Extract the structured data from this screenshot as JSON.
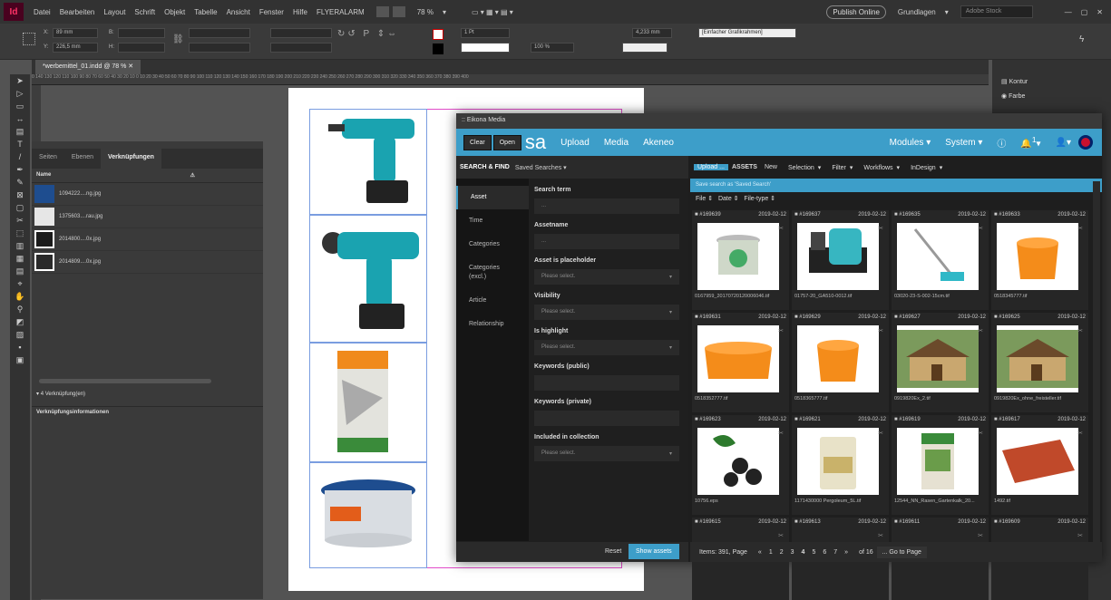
{
  "menubar": {
    "logo": "Id",
    "items": [
      "Datei",
      "Bearbeiten",
      "Layout",
      "Schrift",
      "Objekt",
      "Tabelle",
      "Ansicht",
      "Fenster",
      "Hilfe",
      "FLYERALARM"
    ],
    "zoom": "78 %",
    "publish": "Publish Online",
    "workspace": "Grundlagen",
    "search_placeholder": "Adobe Stock"
  },
  "control": {
    "x": "89 mm",
    "y": "226,5 mm",
    "b": "",
    "h": "",
    "stroke": "1 Pt",
    "size": "4,233 mm",
    "scale": "100 %",
    "frame_style": "[Einfacher Grafikrahmen]"
  },
  "document_tab": "*werbemittel_01.indd @ 78 %",
  "ruler_text": "0  140  130  120  110  100  90  80  70  60  50  40  30  20  10  0  10  20  30  40  50  60  70  80  90  100  110  120  130  140  150  160  170  180  190  200  210  220  230  240  250  260  270  280  290  300  310  320  330  340  350  360  370  380  390  400",
  "links_panel": {
    "tabs": [
      "Seiten",
      "Ebenen",
      "Verknüpfungen"
    ],
    "name_header": "Name",
    "links": [
      "1094222....ng.jpg",
      "1375603....rau.jpg",
      "2014800....0x.jpg",
      "2014809....0x.jpg"
    ],
    "count": "4 Verknüpfung(en)",
    "info": "Verknüpfungsinformationen"
  },
  "right_panel": {
    "items": [
      "Kontur",
      "Farbe"
    ]
  },
  "eikona": {
    "title": "Eikona Media",
    "brand": "sa",
    "clear": "Clear",
    "open": "Open",
    "nav": [
      "Upload",
      "Media",
      "Akeneo"
    ],
    "nav_right": [
      "Modules",
      "System"
    ],
    "notif_count": "1",
    "search_find": "SEARCH & FIND",
    "saved_searches": "Saved Searches",
    "categories": [
      "Asset",
      "Time",
      "Categories",
      "Categories (excl.)",
      "Article",
      "Relationship"
    ],
    "fields": [
      {
        "label": "Search term",
        "value": "..."
      },
      {
        "label": "Assetname",
        "value": "..."
      },
      {
        "label": "Asset is placeholder",
        "value": "Please select."
      },
      {
        "label": "Visibility",
        "value": "Please select."
      },
      {
        "label": "Is highlight",
        "value": "Please select."
      },
      {
        "label": "Keywords (public)",
        "value": ""
      },
      {
        "label": "Keywords (private)",
        "value": ""
      },
      {
        "label": "Included in collection",
        "value": "Please select."
      }
    ],
    "reset": "Reset",
    "show_assets": "Show assets",
    "toolbar": [
      "Upload ...",
      "ASSETS",
      "New",
      "Selection",
      "Filter",
      "Workflows",
      "InDesign"
    ],
    "save_search": "Save search as 'Saved Search'",
    "sort": [
      "File",
      "Date",
      "File-type"
    ],
    "assets": [
      {
        "id": "#169639",
        "date": "2019-02-12",
        "name": "0167959_20170720120006046.tif",
        "kind": "bucket"
      },
      {
        "id": "#169637",
        "date": "2019-02-12",
        "name": "01757-20_GA510-0012.tif",
        "kind": "pump"
      },
      {
        "id": "#169635",
        "date": "2019-02-12",
        "name": "03020-23-S-002-15cm.tif",
        "kind": "rake"
      },
      {
        "id": "#169633",
        "date": "2019-02-12",
        "name": "0518345777.tif",
        "kind": "box"
      },
      {
        "id": "#169631",
        "date": "2019-02-12",
        "name": "0518352777.tif",
        "kind": "box2"
      },
      {
        "id": "#169629",
        "date": "2019-02-12",
        "name": "0518365777.tif",
        "kind": "box"
      },
      {
        "id": "#169627",
        "date": "2019-02-12",
        "name": "0919820Ex_2.tif",
        "kind": "house"
      },
      {
        "id": "#169625",
        "date": "2019-02-12",
        "name": "0919820Ex_ohne_freisteller.tif",
        "kind": "house"
      },
      {
        "id": "#169623",
        "date": "2019-02-12",
        "name": "10756.eps",
        "kind": "berry"
      },
      {
        "id": "#169621",
        "date": "2019-02-12",
        "name": "1171430000 Pergoleum_5L.tif",
        "kind": "can"
      },
      {
        "id": "#169619",
        "date": "2019-02-12",
        "name": "12544_NN_Rasen_Gartenkalk_20...",
        "kind": "sack"
      },
      {
        "id": "#169617",
        "date": "2019-02-12",
        "name": "1492.tif",
        "kind": "mat"
      },
      {
        "id": "#169615",
        "date": "2019-02-12",
        "name": "",
        "kind": "blank"
      },
      {
        "id": "#169613",
        "date": "2019-02-12",
        "name": "",
        "kind": "blank"
      },
      {
        "id": "#169611",
        "date": "2019-02-12",
        "name": "",
        "kind": "blank"
      },
      {
        "id": "#169609",
        "date": "2019-02-12",
        "name": "",
        "kind": "blank"
      }
    ],
    "items_label": "Items: 391, Page",
    "pages": [
      "«",
      "1",
      "2",
      "3",
      "4",
      "5",
      "6",
      "7",
      "»"
    ],
    "current_page": "4",
    "of": "of 16",
    "goto": "... Go to Page"
  },
  "colors": {
    "accent": "#3d9ec9",
    "ui_dark": "#323232",
    "frame": "#7a9de0"
  }
}
